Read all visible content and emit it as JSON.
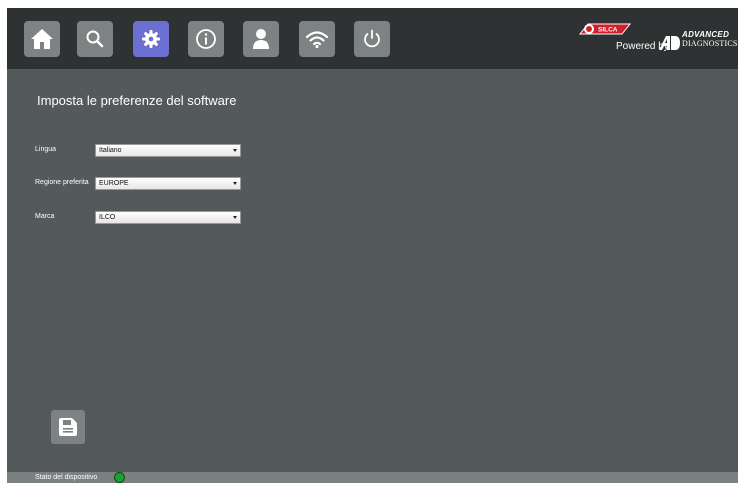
{
  "colors": {
    "topbar": "#2f3233",
    "background": "#54595b",
    "nav_button": "#7d8283",
    "nav_button_active": "#6d6fd0",
    "status_ok": "#1aa12f"
  },
  "nav": {
    "items": [
      {
        "icon": "home-icon",
        "active": false
      },
      {
        "icon": "search-icon",
        "active": false
      },
      {
        "icon": "gear-icon",
        "active": true
      },
      {
        "icon": "info-icon",
        "active": false
      },
      {
        "icon": "user-icon",
        "active": false
      },
      {
        "icon": "wifi-icon",
        "active": false
      },
      {
        "icon": "power-icon",
        "active": false
      }
    ]
  },
  "brand": {
    "logo_text": "SILCA",
    "powered_by": "Powered by",
    "partner_line1": "ADVANCED",
    "partner_line2": "DIAGNOSTICS"
  },
  "page": {
    "title": "Imposta le preferenze del software"
  },
  "form": {
    "language_label": "Lingua",
    "language_value": "Italiano",
    "region_label": "Regione preferita",
    "region_value": "EUROPE",
    "brand_label": "Marca",
    "brand_value": "ILCO"
  },
  "footer": {
    "save_icon": "save-icon",
    "status_label": "Stato del dispositivo"
  }
}
